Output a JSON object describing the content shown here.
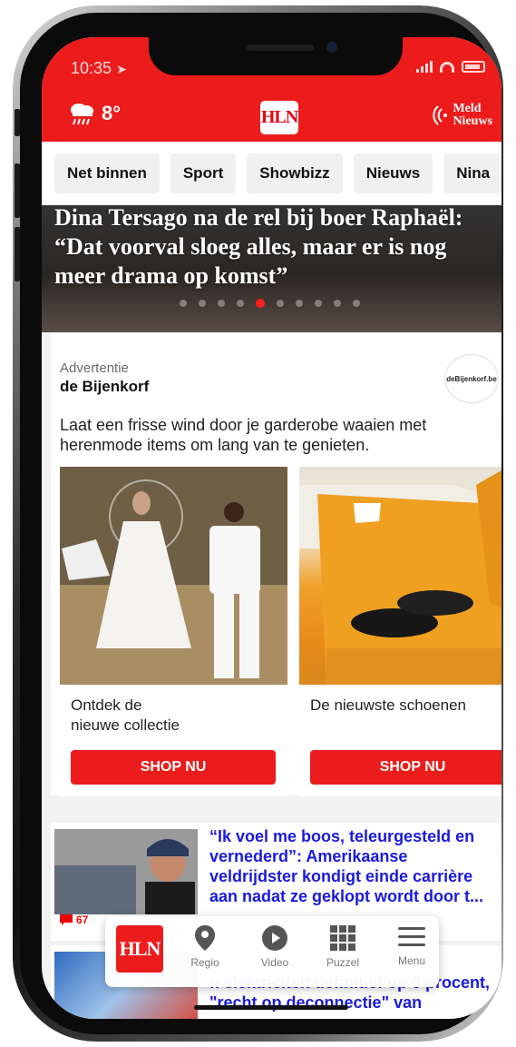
{
  "status": {
    "time": "10:35"
  },
  "header": {
    "temperature": "8°",
    "logo": "HLN",
    "meld_line1": "Meld",
    "meld_line2": "Nieuws"
  },
  "tabs": [
    "Net binnen",
    "Sport",
    "Showbizz",
    "Nieuws",
    "Nina"
  ],
  "hero": {
    "title": "Dina Tersago na de rel bij boer Raphaël: “Dat voorval sloeg alles, maar er is nog meer drama op komst”",
    "active_dot": 5,
    "dot_count": 10
  },
  "ad": {
    "label": "Advertentie",
    "brand": "de Bijenkorf",
    "badge": "deBijenkorf.be",
    "text": "Laat een frisse wind door je garderobe waaien met herenmode items om lang van te genieten.",
    "cards": [
      {
        "caption_line1": "Ontdek de",
        "caption_line2": "nieuwe collectie",
        "button": "SHOP NU"
      },
      {
        "caption_line1": "De nieuwste schoenen",
        "caption_line2": "",
        "button": "SHOP NU"
      }
    ]
  },
  "articles": [
    {
      "title": "“Ik voel me boos, teleurgesteld en vernederd”: Amerikaanse veldrijdster kondigt einde carrière aan nadat ze geklopt wordt door t...",
      "comments": "67"
    },
    {
      "title_visible": "n elektriciteit definitief op 6 procent, \"recht op deconnectie\" van"
    }
  ],
  "bottom_nav": {
    "logo": "HLN",
    "items": [
      {
        "label": "Regio",
        "icon": "location-pin-icon"
      },
      {
        "label": "Video",
        "icon": "play-icon"
      },
      {
        "label": "Puzzel",
        "icon": "puzzle-grid-icon"
      },
      {
        "label": "Menu",
        "icon": "hamburger-icon"
      }
    ]
  },
  "colors": {
    "brand_red": "#ec1c1c",
    "link_blue": "#1a1adb"
  }
}
